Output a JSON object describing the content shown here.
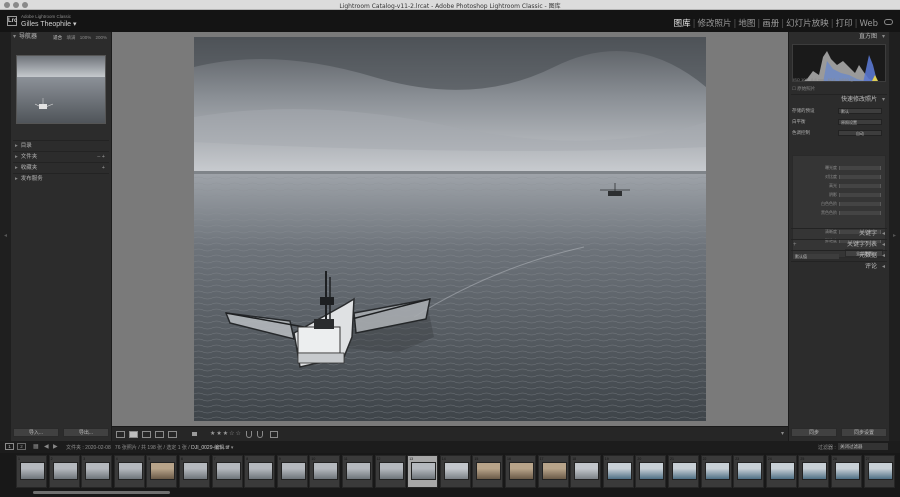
{
  "window": {
    "title": "Lightroom Catalog-v11-2.lrcat - Adobe Photoshop Lightroom Classic - 图库"
  },
  "identity": {
    "small": "Adobe Lightroom Classic",
    "name": "Gilles Theophile",
    "logo": "Lrc"
  },
  "modules": {
    "items": [
      "图库",
      "修改照片",
      "地图",
      "画册",
      "幻灯片放映",
      "打印",
      "Web"
    ],
    "active": "图库"
  },
  "left_panel": {
    "navigator_title": "导航器",
    "nav_opts": [
      "适合",
      "填满",
      "100%",
      "200%"
    ],
    "sections": [
      "目录",
      "文件夹",
      "收藏夹",
      "发布服务"
    ],
    "import_label": "导入...",
    "export_label": "导出..."
  },
  "right_panel": {
    "histogram_title": "直方图",
    "histogram_info": [
      "ISO 100",
      "8.8 mm",
      "f/2.8",
      "1/640 秒"
    ],
    "original_photo": "原始照片",
    "quick_develop_title": "快速修改照片",
    "saved_preset_label": "存储的预设",
    "saved_preset_value": "默认",
    "white_balance_label": "白平衡",
    "white_balance_value": "原照设置",
    "tone_label": "色调控制",
    "tone_auto": "自动",
    "tone_rows": [
      "曝光度",
      "对比度",
      "高光",
      "阴影",
      "白色色阶",
      "黑色色阶"
    ],
    "presence_rows": [
      "清晰度",
      "鲜艳度"
    ],
    "reset_all": "全部重置",
    "keywords_title": "关键字",
    "keyword_list_title": "关键字列表",
    "metadata_default": "默认值",
    "metadata_title": "元数据",
    "comments_title": "评论",
    "sync_label": "同步",
    "sync_settings_label": "同步设置"
  },
  "toolbar": {
    "stars": "★★★☆☆",
    "rating": 3
  },
  "filmbar": {
    "page_nums": [
      "1",
      "2"
    ],
    "source": "文件夹 : 2020-02-08",
    "count": "76 张照片 / 共 198 张",
    "selected": "选定 1 张",
    "filename": "DJI_0029-编辑.tif",
    "filter_label": "过滤器 :",
    "filter_value": "关闭过滤器"
  },
  "filmstrip": {
    "cells": [
      {
        "num": "1",
        "scene": "sea"
      },
      {
        "num": "2",
        "scene": "sea"
      },
      {
        "num": "3",
        "scene": "sea"
      },
      {
        "num": "4",
        "scene": "sea"
      },
      {
        "num": "5",
        "scene": "warm"
      },
      {
        "num": "6",
        "scene": "sea"
      },
      {
        "num": "7",
        "scene": "sea"
      },
      {
        "num": "8",
        "scene": "sea"
      },
      {
        "num": "9",
        "scene": "sea"
      },
      {
        "num": "10",
        "scene": "sea"
      },
      {
        "num": "11",
        "scene": "sea"
      },
      {
        "num": "12",
        "scene": "sea"
      },
      {
        "num": "13",
        "scene": "sea",
        "selected": true
      },
      {
        "num": "14",
        "scene": "sky"
      },
      {
        "num": "15",
        "scene": "warm"
      },
      {
        "num": "16",
        "scene": "warm"
      },
      {
        "num": "17",
        "scene": "warm"
      },
      {
        "num": "18",
        "scene": "sky"
      },
      {
        "num": "19",
        "scene": "color"
      },
      {
        "num": "20",
        "scene": "color"
      },
      {
        "num": "21",
        "scene": "color"
      },
      {
        "num": "22",
        "scene": "color"
      },
      {
        "num": "23",
        "scene": "color"
      },
      {
        "num": "24",
        "scene": "color"
      },
      {
        "num": "25",
        "scene": "color"
      },
      {
        "num": "26",
        "scene": "color"
      },
      {
        "num": "27",
        "scene": "color"
      }
    ]
  }
}
